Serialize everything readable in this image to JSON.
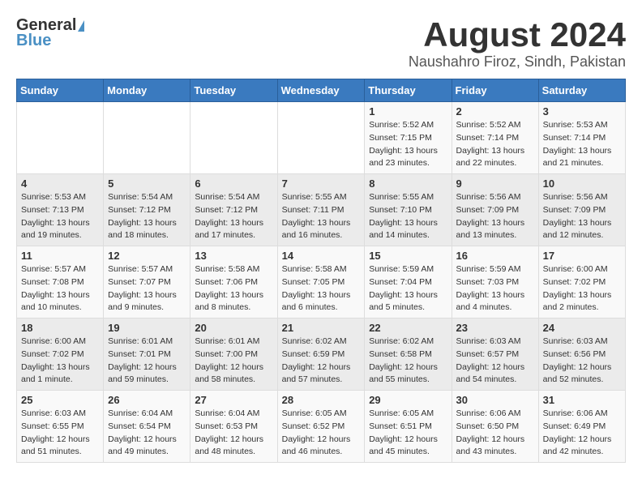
{
  "header": {
    "logo_general": "General",
    "logo_blue": "Blue",
    "title": "August 2024",
    "subtitle": "Naushahro Firoz, Sindh, Pakistan"
  },
  "weekdays": [
    "Sunday",
    "Monday",
    "Tuesday",
    "Wednesday",
    "Thursday",
    "Friday",
    "Saturday"
  ],
  "weeks": [
    [
      {
        "day": "",
        "info": ""
      },
      {
        "day": "",
        "info": ""
      },
      {
        "day": "",
        "info": ""
      },
      {
        "day": "",
        "info": ""
      },
      {
        "day": "1",
        "info": "Sunrise: 5:52 AM\nSunset: 7:15 PM\nDaylight: 13 hours\nand 23 minutes."
      },
      {
        "day": "2",
        "info": "Sunrise: 5:52 AM\nSunset: 7:14 PM\nDaylight: 13 hours\nand 22 minutes."
      },
      {
        "day": "3",
        "info": "Sunrise: 5:53 AM\nSunset: 7:14 PM\nDaylight: 13 hours\nand 21 minutes."
      }
    ],
    [
      {
        "day": "4",
        "info": "Sunrise: 5:53 AM\nSunset: 7:13 PM\nDaylight: 13 hours\nand 19 minutes."
      },
      {
        "day": "5",
        "info": "Sunrise: 5:54 AM\nSunset: 7:12 PM\nDaylight: 13 hours\nand 18 minutes."
      },
      {
        "day": "6",
        "info": "Sunrise: 5:54 AM\nSunset: 7:12 PM\nDaylight: 13 hours\nand 17 minutes."
      },
      {
        "day": "7",
        "info": "Sunrise: 5:55 AM\nSunset: 7:11 PM\nDaylight: 13 hours\nand 16 minutes."
      },
      {
        "day": "8",
        "info": "Sunrise: 5:55 AM\nSunset: 7:10 PM\nDaylight: 13 hours\nand 14 minutes."
      },
      {
        "day": "9",
        "info": "Sunrise: 5:56 AM\nSunset: 7:09 PM\nDaylight: 13 hours\nand 13 minutes."
      },
      {
        "day": "10",
        "info": "Sunrise: 5:56 AM\nSunset: 7:09 PM\nDaylight: 13 hours\nand 12 minutes."
      }
    ],
    [
      {
        "day": "11",
        "info": "Sunrise: 5:57 AM\nSunset: 7:08 PM\nDaylight: 13 hours\nand 10 minutes."
      },
      {
        "day": "12",
        "info": "Sunrise: 5:57 AM\nSunset: 7:07 PM\nDaylight: 13 hours\nand 9 minutes."
      },
      {
        "day": "13",
        "info": "Sunrise: 5:58 AM\nSunset: 7:06 PM\nDaylight: 13 hours\nand 8 minutes."
      },
      {
        "day": "14",
        "info": "Sunrise: 5:58 AM\nSunset: 7:05 PM\nDaylight: 13 hours\nand 6 minutes."
      },
      {
        "day": "15",
        "info": "Sunrise: 5:59 AM\nSunset: 7:04 PM\nDaylight: 13 hours\nand 5 minutes."
      },
      {
        "day": "16",
        "info": "Sunrise: 5:59 AM\nSunset: 7:03 PM\nDaylight: 13 hours\nand 4 minutes."
      },
      {
        "day": "17",
        "info": "Sunrise: 6:00 AM\nSunset: 7:02 PM\nDaylight: 13 hours\nand 2 minutes."
      }
    ],
    [
      {
        "day": "18",
        "info": "Sunrise: 6:00 AM\nSunset: 7:02 PM\nDaylight: 13 hours\nand 1 minute."
      },
      {
        "day": "19",
        "info": "Sunrise: 6:01 AM\nSunset: 7:01 PM\nDaylight: 12 hours\nand 59 minutes."
      },
      {
        "day": "20",
        "info": "Sunrise: 6:01 AM\nSunset: 7:00 PM\nDaylight: 12 hours\nand 58 minutes."
      },
      {
        "day": "21",
        "info": "Sunrise: 6:02 AM\nSunset: 6:59 PM\nDaylight: 12 hours\nand 57 minutes."
      },
      {
        "day": "22",
        "info": "Sunrise: 6:02 AM\nSunset: 6:58 PM\nDaylight: 12 hours\nand 55 minutes."
      },
      {
        "day": "23",
        "info": "Sunrise: 6:03 AM\nSunset: 6:57 PM\nDaylight: 12 hours\nand 54 minutes."
      },
      {
        "day": "24",
        "info": "Sunrise: 6:03 AM\nSunset: 6:56 PM\nDaylight: 12 hours\nand 52 minutes."
      }
    ],
    [
      {
        "day": "25",
        "info": "Sunrise: 6:03 AM\nSunset: 6:55 PM\nDaylight: 12 hours\nand 51 minutes."
      },
      {
        "day": "26",
        "info": "Sunrise: 6:04 AM\nSunset: 6:54 PM\nDaylight: 12 hours\nand 49 minutes."
      },
      {
        "day": "27",
        "info": "Sunrise: 6:04 AM\nSunset: 6:53 PM\nDaylight: 12 hours\nand 48 minutes."
      },
      {
        "day": "28",
        "info": "Sunrise: 6:05 AM\nSunset: 6:52 PM\nDaylight: 12 hours\nand 46 minutes."
      },
      {
        "day": "29",
        "info": "Sunrise: 6:05 AM\nSunset: 6:51 PM\nDaylight: 12 hours\nand 45 minutes."
      },
      {
        "day": "30",
        "info": "Sunrise: 6:06 AM\nSunset: 6:50 PM\nDaylight: 12 hours\nand 43 minutes."
      },
      {
        "day": "31",
        "info": "Sunrise: 6:06 AM\nSunset: 6:49 PM\nDaylight: 12 hours\nand 42 minutes."
      }
    ]
  ]
}
